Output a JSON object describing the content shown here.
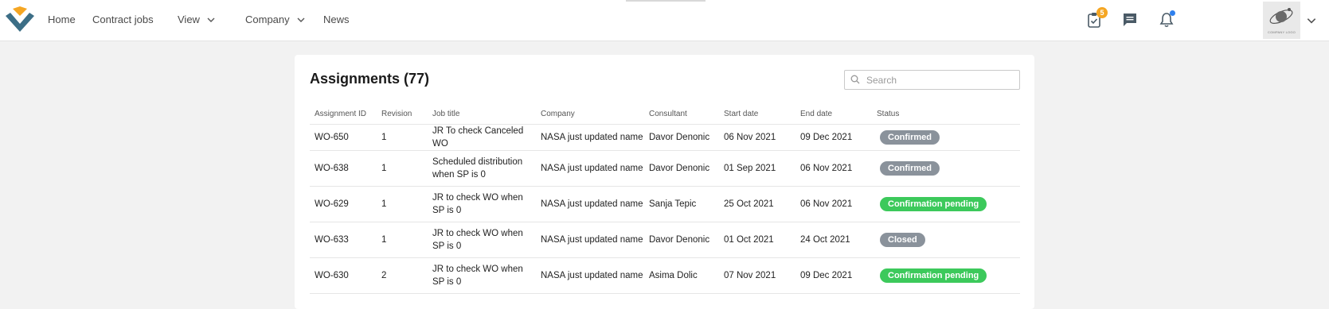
{
  "nav": {
    "items": [
      {
        "label": "Home"
      },
      {
        "label": "Contract jobs"
      },
      {
        "label": "View"
      },
      {
        "label": "Company"
      },
      {
        "label": "News"
      }
    ],
    "tasks_badge": "5",
    "company_logo_text": "COMPANY LOGO"
  },
  "colors": {
    "brand_orange": "#f5a623",
    "brand_teal": "#3c6e86",
    "status_confirmed": "#8a929b",
    "status_pending": "#3cc95b",
    "status_closed": "#8a929b"
  },
  "assignments": {
    "title": "Assignments (77)",
    "search_placeholder": "Search",
    "columns": [
      "Assignment ID",
      "Revision",
      "Job title",
      "Company",
      "Consultant",
      "Start date",
      "End date",
      "Status"
    ],
    "rows": [
      {
        "id": "WO-650",
        "revision": "1",
        "job_title": "JR To check Canceled WO",
        "company": "NASA just updated name",
        "consultant": "Davor Denonic",
        "start": "06 Nov 2021",
        "end": "09 Dec 2021",
        "status": "Confirmed"
      },
      {
        "id": "WO-638",
        "revision": "1",
        "job_title": "Scheduled distribution when SP is 0",
        "company": "NASA just updated name",
        "consultant": "Davor Denonic",
        "start": "01 Sep 2021",
        "end": "06 Nov 2021",
        "status": "Confirmed"
      },
      {
        "id": "WO-629",
        "revision": "1",
        "job_title": "JR to check WO when SP is 0",
        "company": "NASA just updated name",
        "consultant": "Sanja Tepic",
        "start": "25 Oct 2021",
        "end": "06 Nov 2021",
        "status": "Confirmation pending"
      },
      {
        "id": "WO-633",
        "revision": "1",
        "job_title": "JR to check WO when SP is 0",
        "company": "NASA just updated name",
        "consultant": "Davor Denonic",
        "start": "01 Oct 2021",
        "end": "24 Oct 2021",
        "status": "Closed"
      },
      {
        "id": "WO-630",
        "revision": "2",
        "job_title": "JR to check WO when SP is 0",
        "company": "NASA just updated name",
        "consultant": "Asima Dolic",
        "start": "07 Nov 2021",
        "end": "09 Dec 2021",
        "status": "Confirmation pending"
      }
    ]
  }
}
